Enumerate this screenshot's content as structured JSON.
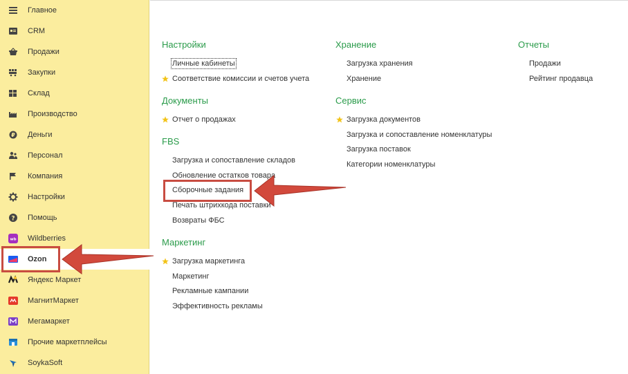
{
  "sidebar": {
    "items": [
      {
        "label": "Главное",
        "icon": "menu-lines-icon"
      },
      {
        "label": "CRM",
        "icon": "contact-card-icon"
      },
      {
        "label": "Продажи",
        "icon": "basket-icon"
      },
      {
        "label": "Закупки",
        "icon": "purchase-icon"
      },
      {
        "label": "Склад",
        "icon": "warehouse-icon"
      },
      {
        "label": "Производство",
        "icon": "factory-icon"
      },
      {
        "label": "Деньги",
        "icon": "money-icon"
      },
      {
        "label": "Персонал",
        "icon": "people-icon"
      },
      {
        "label": "Компания",
        "icon": "flag-icon"
      },
      {
        "label": "Настройки",
        "icon": "gear-icon"
      },
      {
        "label": "Помощь",
        "icon": "help-icon"
      },
      {
        "label": "Wildberries",
        "icon": "wildberries-logo-icon"
      },
      {
        "label": "Ozon",
        "icon": "ozon-logo-icon"
      },
      {
        "label": "Яндекс Маркет",
        "icon": "yandex-market-logo-icon"
      },
      {
        "label": "МагнитМаркет",
        "icon": "magnit-market-logo-icon"
      },
      {
        "label": "Мегамаркет",
        "icon": "megamarket-logo-icon"
      },
      {
        "label": "Прочие маркетплейсы",
        "icon": "marketplaces-icon"
      },
      {
        "label": "SoykaSoft",
        "icon": "soykasoft-logo-icon"
      }
    ],
    "active_index": 12
  },
  "sections": {
    "settings": {
      "title": "Настройки",
      "items": [
        "Личные кабинеты",
        "Соответствие комиссии и счетов учета"
      ]
    },
    "documents": {
      "title": "Документы",
      "items": [
        "Отчет о продажах"
      ]
    },
    "fbs": {
      "title": "FBS",
      "items": [
        "Загрузка и сопоставление складов",
        "Обновление остатков товара",
        "Сборочные задания",
        "Печать штрихкода поставки",
        "Возвраты ФБС"
      ]
    },
    "marketing": {
      "title": "Маркетинг",
      "items": [
        "Загрузка маркетинга",
        "Маркетинг",
        "Рекламные кампании",
        "Эффективность рекламы"
      ]
    },
    "storage": {
      "title": "Хранение",
      "items": [
        "Загрузка хранения",
        "Хранение"
      ]
    },
    "service": {
      "title": "Сервис",
      "items": [
        "Загрузка документов",
        "Загрузка и сопоставление номенклатуры",
        "Загрузка поставок",
        "Категории номенклатуры"
      ]
    },
    "reports": {
      "title": "Отчеты",
      "items": [
        "Продажи",
        "Рейтинг продавца"
      ]
    }
  },
  "colors": {
    "sidebar_bg": "#fbed9e",
    "section_title": "#2a9b4a",
    "highlight": "#c84c41",
    "star": "#f2c318"
  }
}
